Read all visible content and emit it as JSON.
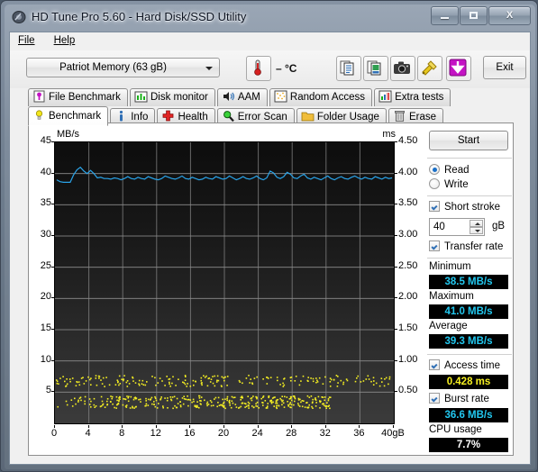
{
  "window": {
    "title": "HD Tune Pro 5.60 - Hard Disk/SSD Utility",
    "icon": "hdtune-app-icon",
    "minimize_label": "",
    "maximize_label": "",
    "close_label": "X"
  },
  "menu": {
    "items": [
      "File",
      "Help"
    ]
  },
  "toolbar": {
    "drive_combo_value": "Patriot Memory (63 gB)",
    "temperature_value": "– °C",
    "temperature_icon": "thermometer-icon",
    "buttons": [
      {
        "name": "copy-text-button",
        "icon": "copy-text-icon"
      },
      {
        "name": "copy-image-button",
        "icon": "copy-image-icon"
      },
      {
        "name": "screenshot-button",
        "icon": "camera-icon"
      },
      {
        "name": "settings-button",
        "icon": "tools-icon"
      },
      {
        "name": "save-button",
        "icon": "download-arrow-icon"
      }
    ],
    "exit_label": "Exit"
  },
  "tabs": {
    "row1": [
      {
        "label": "File Benchmark",
        "icon": "file-benchmark-icon",
        "selected": false
      },
      {
        "label": "Disk monitor",
        "icon": "bar-chart-icon",
        "selected": false
      },
      {
        "label": "AAM",
        "icon": "speaker-icon",
        "selected": false
      },
      {
        "label": "Random Access",
        "icon": "random-access-icon",
        "selected": false
      },
      {
        "label": "Extra tests",
        "icon": "extra-tests-icon",
        "selected": false
      }
    ],
    "row2": [
      {
        "label": "Benchmark",
        "icon": "bulb-icon",
        "selected": true
      },
      {
        "label": "Info",
        "icon": "info-icon",
        "selected": false
      },
      {
        "label": "Health",
        "icon": "health-cross-icon",
        "selected": false
      },
      {
        "label": "Error Scan",
        "icon": "magnifier-icon",
        "selected": false
      },
      {
        "label": "Folder Usage",
        "icon": "folder-icon",
        "selected": false
      },
      {
        "label": "Erase",
        "icon": "trash-icon",
        "selected": false
      }
    ]
  },
  "controls": {
    "start_label": "Start",
    "mode_read_label": "Read",
    "mode_write_label": "Write",
    "mode_selected": "Read",
    "short_stroke_label": "Short stroke",
    "short_stroke_checked": true,
    "short_stroke_value": "40",
    "short_stroke_unit": "gB",
    "transfer_rate_label": "Transfer rate",
    "transfer_rate_checked": true,
    "minimum_label": "Minimum",
    "minimum_value": "38.5 MB/s",
    "maximum_label": "Maximum",
    "maximum_value": "41.0 MB/s",
    "average_label": "Average",
    "average_value": "39.3 MB/s",
    "access_time_label": "Access time",
    "access_time_checked": true,
    "access_time_value": "0.428 ms",
    "burst_rate_label": "Burst rate",
    "burst_rate_checked": true,
    "burst_rate_value": "36.6 MB/s",
    "cpu_usage_label": "CPU usage",
    "cpu_usage_value": "7.7%"
  },
  "colors": {
    "transfer_rate_line": "#2aa3e8",
    "access_time_dots": "#f5ef22",
    "lcd_background": "#000000",
    "plot_grid": "#8a8a8a"
  },
  "chart_data": {
    "type": "line",
    "title": "",
    "xlabel": "gB",
    "ylabel": "MB/s",
    "y2label": "ms",
    "xlim": [
      0,
      40
    ],
    "ylim": [
      0,
      45
    ],
    "y2lim": [
      0,
      4.5
    ],
    "grid": true,
    "legend": "none",
    "xticks": [
      0,
      4,
      8,
      12,
      16,
      20,
      24,
      28,
      32,
      36,
      40
    ],
    "xtick_labels": [
      "0",
      "4",
      "8",
      "12",
      "16",
      "20",
      "24",
      "28",
      "32",
      "36",
      "40gB"
    ],
    "yticks": [
      0,
      5,
      10,
      15,
      20,
      25,
      30,
      35,
      40,
      45
    ],
    "ytick_labels": [
      "",
      "5",
      "10",
      "15",
      "20",
      "25",
      "30",
      "35",
      "40",
      "45"
    ],
    "y2ticks": [
      0.5,
      1.0,
      1.5,
      2.0,
      2.5,
      3.0,
      3.5,
      4.0,
      4.5
    ],
    "y2tick_labels": [
      "0.50",
      "1.00",
      "1.50",
      "2.00",
      "2.50",
      "3.00",
      "3.50",
      "4.00",
      "4.50"
    ],
    "series": [
      {
        "name": "Transfer rate",
        "color": "#2aa3e8",
        "axis": "left",
        "unit": "MB/s",
        "x": [
          0.2,
          0.6,
          1.0,
          1.4,
          1.8,
          2.2,
          2.6,
          3.0,
          3.4,
          3.8,
          4.2,
          4.6,
          5.0,
          5.4,
          5.8,
          6.2,
          6.6,
          7.0,
          7.4,
          7.8,
          8.2,
          8.6,
          9.0,
          9.4,
          9.8,
          10.2,
          10.6,
          11.0,
          11.4,
          11.8,
          12.2,
          12.6,
          13.0,
          13.4,
          13.8,
          14.2,
          14.6,
          15.0,
          15.4,
          15.8,
          16.2,
          16.6,
          17.0,
          17.4,
          17.8,
          18.2,
          18.6,
          19.0,
          19.4,
          19.8,
          20.2,
          20.6,
          21.0,
          21.4,
          21.8,
          22.2,
          22.6,
          23.0,
          23.4,
          23.8,
          24.2,
          24.6,
          25.0,
          25.4,
          25.8,
          26.2,
          26.6,
          27.0,
          27.4,
          27.8,
          28.2,
          28.6,
          29.0,
          29.4,
          29.8,
          30.2,
          30.6,
          31.0,
          31.4,
          31.8,
          32.2,
          32.6,
          33.0,
          33.4,
          33.8,
          34.2,
          34.6,
          35.0,
          35.4,
          35.8,
          36.2,
          36.6,
          37.0,
          37.4,
          37.8,
          38.2,
          38.6,
          39.0,
          39.4,
          39.8
        ],
        "y": [
          39.0,
          38.7,
          38.6,
          38.6,
          38.6,
          39.8,
          40.6,
          41.0,
          40.4,
          40.0,
          40.5,
          40.0,
          39.3,
          39.4,
          39.2,
          39.2,
          39.1,
          39.3,
          39.2,
          39.0,
          39.2,
          39.5,
          39.2,
          39.1,
          39.4,
          39.2,
          39.1,
          39.5,
          39.3,
          39.1,
          39.0,
          39.2,
          39.6,
          39.4,
          39.2,
          39.1,
          39.3,
          39.6,
          39.2,
          39.1,
          39.4,
          39.2,
          39.0,
          39.1,
          39.4,
          39.2,
          39.1,
          39.5,
          39.3,
          39.1,
          39.2,
          39.6,
          39.3,
          39.0,
          39.2,
          39.5,
          39.2,
          39.1,
          39.3,
          39.6,
          39.2,
          39.0,
          39.3,
          40.4,
          40.1,
          39.4,
          39.2,
          39.5,
          40.2,
          39.9,
          39.3,
          39.2,
          39.6,
          39.9,
          39.3,
          39.1,
          39.4,
          39.2,
          39.0,
          39.3,
          39.6,
          39.2,
          39.0,
          39.3,
          39.5,
          39.2,
          39.1,
          39.4,
          39.6,
          39.3,
          39.1,
          39.4,
          39.2,
          39.1,
          39.5,
          39.3,
          39.1,
          39.4,
          39.2,
          39.3
        ]
      },
      {
        "name": "Access time",
        "color": "#f5ef22",
        "axis": "right",
        "unit": "ms",
        "style": "scatter",
        "description": "Dense lower band of points clustered near 0.28-0.42 ms spanning 0-32 gB (thinning after 28 gB), plus a sparser upper band near 0.62-0.75 ms spanning the full 0-40 gB range.",
        "band_low_range": [
          0.25,
          0.45
        ],
        "band_high_range": [
          0.6,
          0.78
        ]
      }
    ],
    "summary": {
      "minimum_MBps": 38.5,
      "maximum_MBps": 41.0,
      "average_MBps": 39.3,
      "access_time_ms": 0.428,
      "burst_rate_MBps": 36.6,
      "cpu_usage_percent": 7.7
    }
  }
}
